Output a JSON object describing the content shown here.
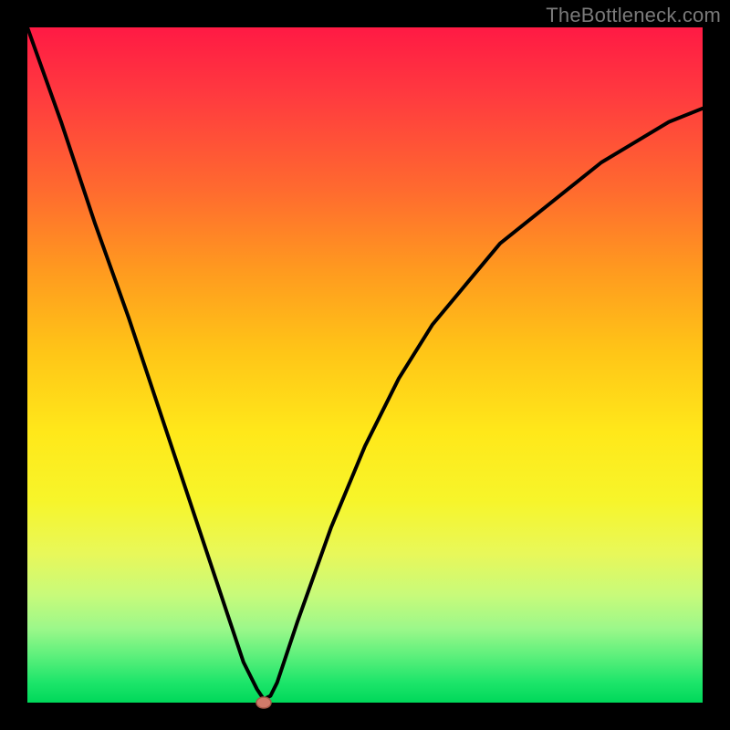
{
  "watermark": "TheBottleneck.com",
  "chart_data": {
    "type": "line",
    "title": "",
    "xlabel": "",
    "ylabel": "",
    "xlim": [
      0,
      100
    ],
    "ylim": [
      0,
      100
    ],
    "background": "rainbow-vertical-red-to-green",
    "series": [
      {
        "name": "bottleneck-curve",
        "x": [
          0,
          5,
          10,
          15,
          20,
          25,
          28,
          30,
          32,
          34,
          35,
          36,
          37,
          40,
          45,
          50,
          55,
          60,
          65,
          70,
          75,
          80,
          85,
          90,
          95,
          100
        ],
        "values": [
          100,
          86,
          71,
          57,
          42,
          27,
          18,
          12,
          6,
          2,
          0.5,
          1,
          3,
          12,
          26,
          38,
          48,
          56,
          62,
          68,
          72,
          76,
          80,
          83,
          86,
          88
        ]
      }
    ],
    "marker": {
      "x": 35,
      "y": 0
    }
  },
  "colors": {
    "border": "#000000",
    "curve": "#000000",
    "marker_fill": "#d07a6a",
    "marker_stroke": "#a55848",
    "watermark": "#7a7a7a"
  }
}
